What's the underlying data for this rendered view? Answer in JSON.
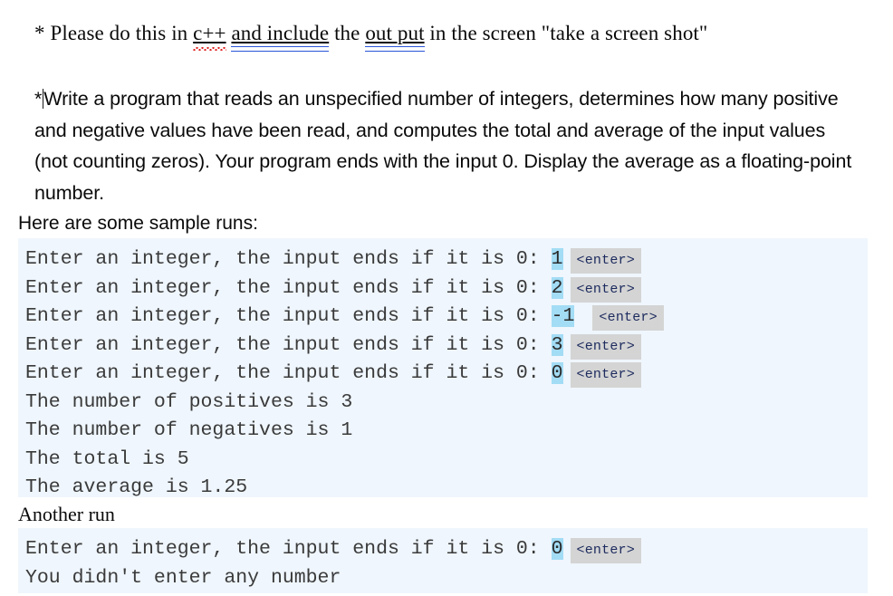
{
  "instruction": {
    "prefix": "* Please do this in ",
    "spell_error_text": "c++",
    "space_1": " ",
    "grammar_error_1": "and  include",
    "mid_text": " the ",
    "grammar_error_2": "out put",
    "suffix": " in the screen \"take a screen shot\""
  },
  "task": {
    "asterisk": "*",
    "body": "Write a program that reads an unspecified number of integers, determines how many positive and negative values have been read, and computes the total and average of the input values (not counting zeros). Your program ends with the input 0. Display the average as a floating-point number."
  },
  "labels": {
    "sample_runs": "Here are some sample runs:",
    "another_run": "Another run"
  },
  "console_1": {
    "prompt": "Enter an integer, the input ends if it is 0: ",
    "enter_key": "<enter>",
    "inputs": [
      "1",
      "2",
      "-1",
      "3",
      "0"
    ],
    "output_lines": [
      "The number of positives is 3",
      "The number of negatives is 1",
      "The total is 5",
      "The average is 1.25"
    ]
  },
  "console_2": {
    "prompt": "Enter an integer, the input ends if it is 0: ",
    "enter_key": "<enter>",
    "inputs": [
      "0"
    ],
    "output_lines": [
      "You didn't enter any number"
    ]
  },
  "colors": {
    "console_background": "#eff6fd",
    "input_highlight": "#a3dcf5",
    "enter_key_background": "#d4d4d4",
    "enter_key_text": "#1d2b5e",
    "spelling_underline": "#e02020",
    "grammar_underline": "#2a56d8",
    "body_text": "#0a0a0a",
    "console_text": "#3a3a3a"
  }
}
